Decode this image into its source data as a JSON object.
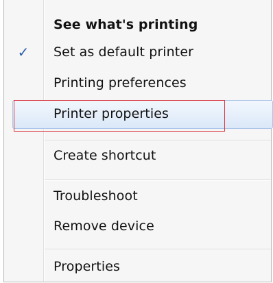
{
  "context_menu": {
    "items": [
      {
        "label": "See what's printing",
        "bold": true
      },
      {
        "label": "Set as default printer",
        "checked": true
      },
      {
        "label": "Printing preferences"
      },
      {
        "label": "Printer properties",
        "highlighted": true
      },
      {
        "label": "Create shortcut"
      },
      {
        "label": "Troubleshoot"
      },
      {
        "label": "Remove device"
      },
      {
        "label": "Properties"
      }
    ],
    "check_glyph": "✓",
    "colors": {
      "highlight": "#dbe8f8",
      "annotation_box": "#d9343f",
      "check": "#2b5fa8"
    }
  }
}
